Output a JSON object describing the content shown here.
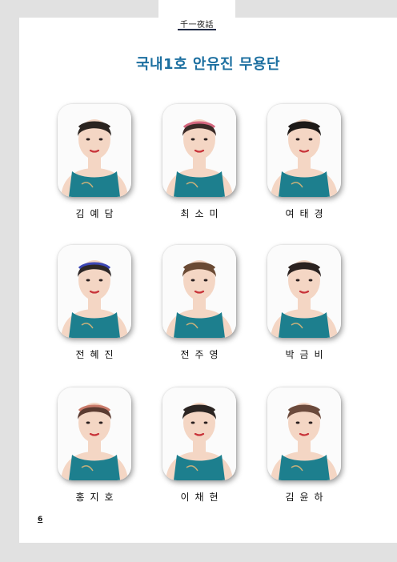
{
  "header": {
    "label": "千一夜話"
  },
  "title": "국내1호 안유진 무용단",
  "members": [
    {
      "name": "김예담",
      "hair_color": "#2b2420",
      "band_color": ""
    },
    {
      "name": "최소미",
      "hair_color": "#3a2a26",
      "band_color": "#d4677e"
    },
    {
      "name": "여태경",
      "hair_color": "#1e1a18",
      "band_color": ""
    },
    {
      "name": "전혜진",
      "hair_color": "#2d2726",
      "band_color": "#3c47b5"
    },
    {
      "name": "전주영",
      "hair_color": "#6a4a34",
      "band_color": ""
    },
    {
      "name": "박금비",
      "hair_color": "#2a2220",
      "band_color": ""
    },
    {
      "name": "홍지호",
      "hair_color": "#5a3a30",
      "band_color": "#c97a6a"
    },
    {
      "name": "이채현",
      "hair_color": "#2b2422",
      "band_color": ""
    },
    {
      "name": "김윤하",
      "hair_color": "#6b4a3c",
      "band_color": ""
    }
  ],
  "colors": {
    "title": "#1c6fa0",
    "costume": "#1d7f8e",
    "skin": "#f4d6c4",
    "page_background": "#e1e1e1"
  },
  "page_number": "6"
}
